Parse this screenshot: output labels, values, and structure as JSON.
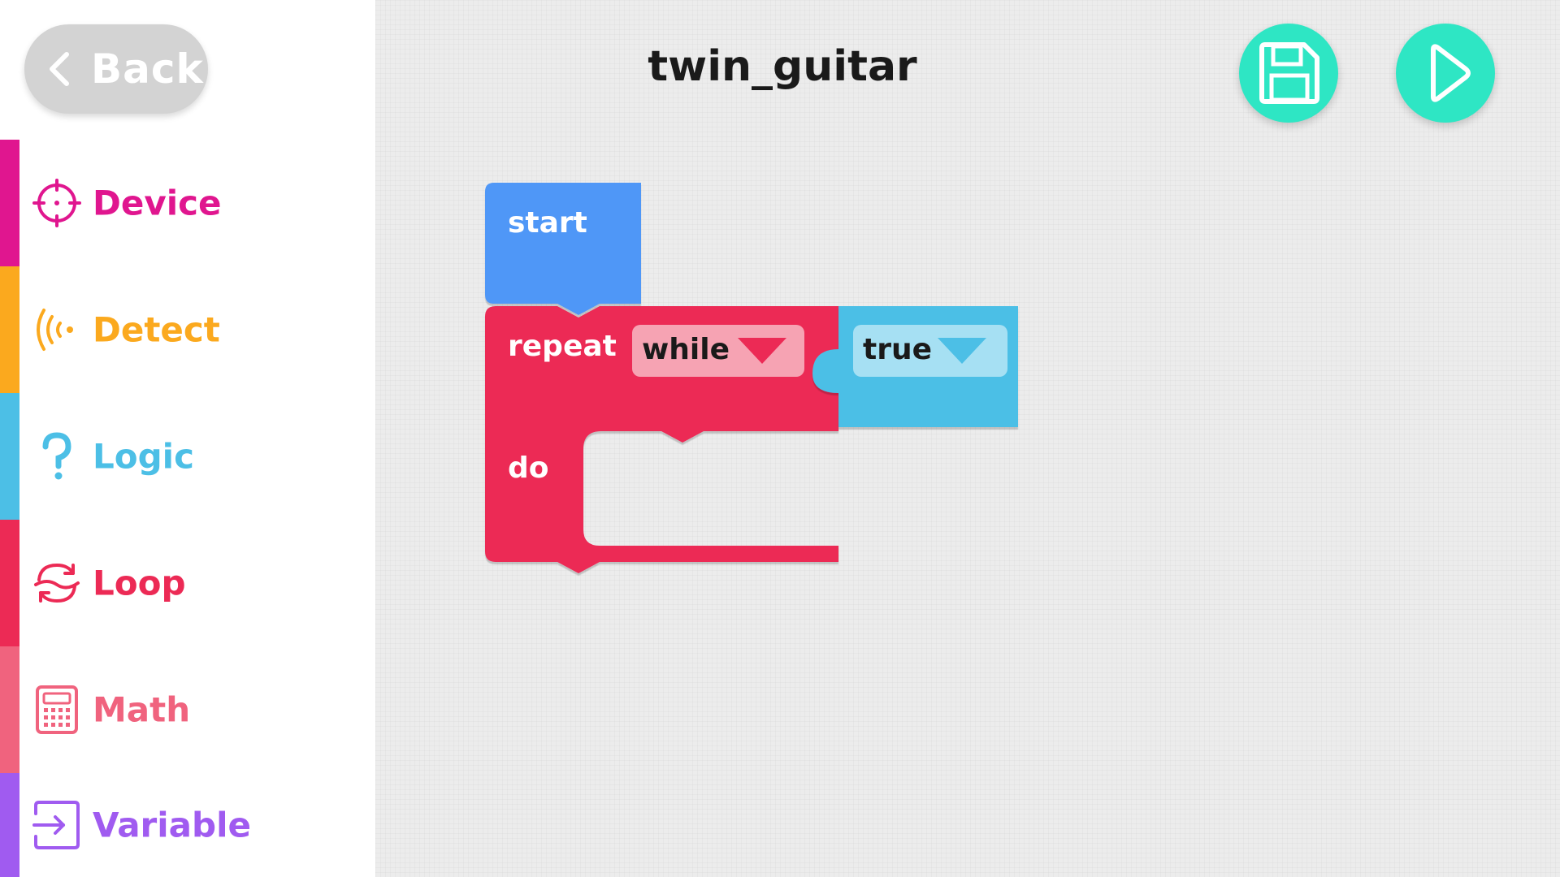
{
  "sidebar": {
    "back_label": "Back",
    "categories": [
      {
        "label": "Device",
        "color": "#e0168f"
      },
      {
        "label": "Detect",
        "color": "#fba91e"
      },
      {
        "label": "Logic",
        "color": "#4cbfe6"
      },
      {
        "label": "Loop",
        "color": "#ec2a55"
      },
      {
        "label": "Math",
        "color": "#f0637e"
      },
      {
        "label": "Variable",
        "color": "#a05bf0"
      }
    ]
  },
  "header": {
    "project_name": "twin_guitar"
  },
  "toolbar": {
    "save_icon": "save-icon",
    "run_icon": "play-icon",
    "accent_color": "#2ee6c4"
  },
  "blocks": {
    "start_label": "start",
    "repeat_label": "repeat",
    "repeat_mode": "while",
    "do_label": "do",
    "condition_value": "true",
    "colors": {
      "start": "#4f97f7",
      "loop": "#ec2a55",
      "logic": "#4cbfe6"
    }
  }
}
